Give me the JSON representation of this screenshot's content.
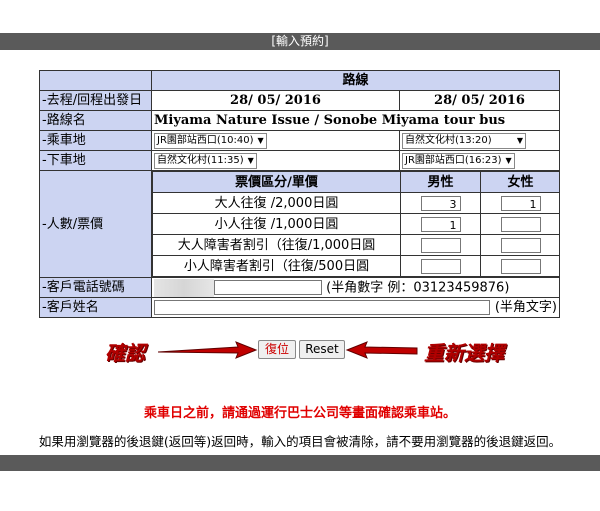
{
  "header": {
    "title": "[輸入預約]"
  },
  "table": {
    "route_header": "路線",
    "rows": {
      "date": {
        "label": "-去程/回程出發日",
        "outbound": "28/ 05/ 2016",
        "return": "28/ 05/ 2016"
      },
      "route": {
        "label": "-路線名",
        "value": "Miyama Nature Issue / Sonobe Miyama tour bus"
      },
      "boarding": {
        "label": "-乘車地",
        "outbound": "JR園部站西口(10:40)",
        "return": "自然文化村(13:20)"
      },
      "alighting": {
        "label": "-下車地",
        "outbound": "自然文化村(11:35)",
        "return": "JR園部站西口(16:23)"
      },
      "passengers": {
        "label": "-人數/票價",
        "col_fare": "票價區分/單價",
        "col_male": "男性",
        "col_female": "女性",
        "items": [
          {
            "fare": "大人往復 /2,000日圓",
            "male": "3",
            "female": "1"
          },
          {
            "fare": "小人往復 /1,000日圓",
            "male": "1",
            "female": ""
          },
          {
            "fare": "大人障害者割引（往復/1,000日圓",
            "male": "",
            "female": ""
          },
          {
            "fare": "小人障害者割引（往復/500日圓",
            "male": "",
            "female": ""
          }
        ]
      },
      "phone": {
        "label": "-客戶電話號碼",
        "hint": "(半角數字 例：03123459876)"
      },
      "name": {
        "label": "-客戶姓名",
        "hint": "(半角文字)"
      }
    }
  },
  "buttons": {
    "confirm": "復位",
    "reset": "Reset"
  },
  "annotations": {
    "left": "確認",
    "right": "重新選擇"
  },
  "notes": {
    "red": "乘車日之前，請通過運行巴士公司等畫面確認乘車站。",
    "black": "如果用瀏覽器的後退鍵(返回等)返回時，輸入的項目會被清除，請不要用瀏覽器的後退鍵返回。"
  },
  "colors": {
    "label_bg": "#ccd4f2",
    "bar": "#5a5a5a",
    "annotation": "#b00000",
    "note_red": "#e00000"
  }
}
